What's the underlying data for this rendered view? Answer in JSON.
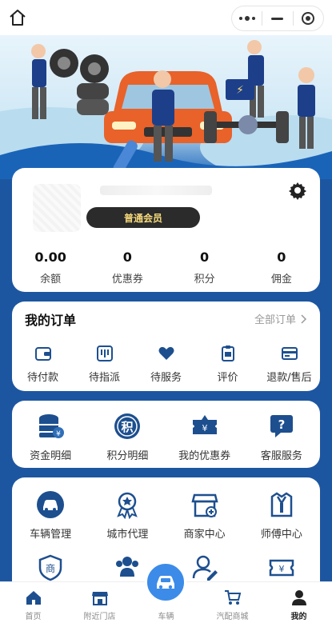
{
  "profile": {
    "member_label": "普通会员",
    "stats": [
      {
        "value": "0.00",
        "label": "余额"
      },
      {
        "value": "0",
        "label": "优惠券"
      },
      {
        "value": "0",
        "label": "积分"
      },
      {
        "value": "0",
        "label": "佣金"
      }
    ]
  },
  "orders": {
    "title": "我的订单",
    "all_label": "全部订单",
    "items": [
      {
        "label": "待付款",
        "icon": "wallet-icon"
      },
      {
        "label": "待指派",
        "icon": "assign-icon"
      },
      {
        "label": "待服务",
        "icon": "heart-icon"
      },
      {
        "label": "评价",
        "icon": "clipboard-icon"
      },
      {
        "label": "退款/售后",
        "icon": "card-icon"
      }
    ]
  },
  "finance": {
    "items": [
      {
        "label": "资金明细",
        "icon": "coins-icon"
      },
      {
        "label": "积分明细",
        "icon": "points-icon",
        "glyph": "积"
      },
      {
        "label": "我的优惠券",
        "icon": "coupon-icon",
        "glyph": "¥"
      },
      {
        "label": "客服服务",
        "icon": "help-icon",
        "glyph": "?"
      }
    ]
  },
  "services": {
    "items": [
      {
        "label": "车辆管理",
        "icon": "car-icon"
      },
      {
        "label": "城市代理",
        "icon": "award-icon"
      },
      {
        "label": "商家中心",
        "icon": "shop-icon"
      },
      {
        "label": "师傅中心",
        "icon": "mechanic-icon"
      }
    ],
    "row2": [
      {
        "icon": "merchant-shield-icon",
        "glyph": "商"
      },
      {
        "icon": "team-icon"
      },
      {
        "icon": "user-edit-icon"
      },
      {
        "icon": "ticket-icon",
        "glyph": "¥"
      }
    ]
  },
  "tabbar": [
    {
      "label": "首页",
      "icon": "home-icon"
    },
    {
      "label": "附近门店",
      "icon": "store-icon"
    },
    {
      "label": "车辆",
      "icon": "car-icon"
    },
    {
      "label": "汽配商城",
      "icon": "cart-icon"
    },
    {
      "label": "我的",
      "icon": "user-icon"
    }
  ],
  "colors": {
    "primary": "#1d56a0",
    "accent": "#3c8be8",
    "member_bg": "#2b2b2b",
    "member_text": "#f5d97a"
  }
}
